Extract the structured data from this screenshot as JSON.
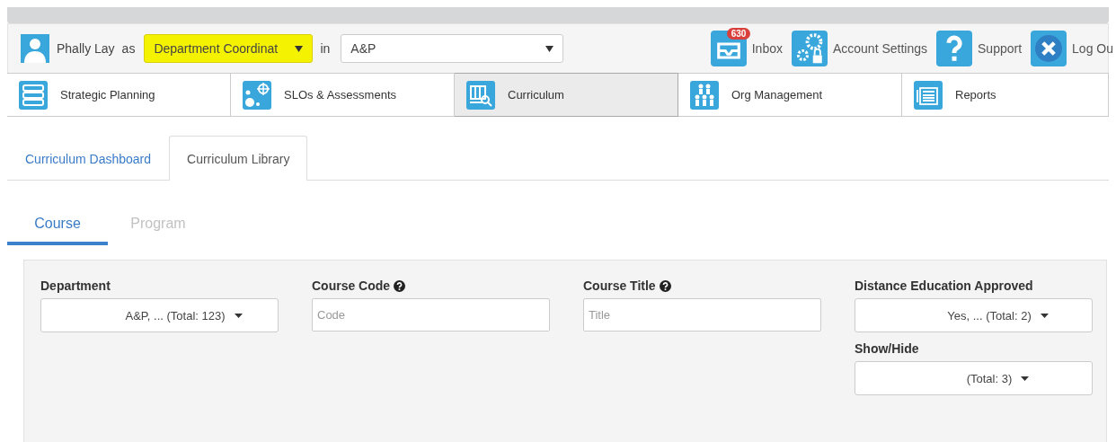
{
  "user_bar": {
    "user_name": "Phally Lay",
    "as_label": "as",
    "role_select": {
      "value": "Department Coordinat",
      "highlighted": true
    },
    "in_label": "in",
    "unit_select": {
      "value": "A&P"
    },
    "links": [
      {
        "kind": "inbox",
        "label": "Inbox",
        "badge": "630"
      },
      {
        "kind": "settings",
        "label": "Account Settings"
      },
      {
        "kind": "support",
        "label": "Support"
      },
      {
        "kind": "logout",
        "label": "Log Ou"
      }
    ]
  },
  "modules": [
    {
      "kind": "planning",
      "label": "Strategic Planning",
      "selected": false
    },
    {
      "kind": "slos",
      "label": "SLOs & Assessments",
      "selected": false
    },
    {
      "kind": "curriculum",
      "label": "Curriculum",
      "selected": true
    },
    {
      "kind": "org",
      "label": "Org Management",
      "selected": false
    },
    {
      "kind": "reports",
      "label": "Reports",
      "selected": false
    }
  ],
  "sub_tabs": [
    {
      "label": "Curriculum Dashboard",
      "selected": false
    },
    {
      "label": "Curriculum Library",
      "selected": true
    }
  ],
  "type_tabs": [
    {
      "label": "Course",
      "selected": true
    },
    {
      "label": "Program",
      "selected": false
    }
  ],
  "filters": [
    {
      "kind": "dropdown",
      "label": "Department",
      "value": "A&P, ... (Total: 123)"
    },
    {
      "kind": "text",
      "label": "Course Code",
      "help": true,
      "placeholder": "Code"
    },
    {
      "kind": "text",
      "label": "Course Title",
      "help": true,
      "placeholder": "Title"
    },
    {
      "kind": "dropdown",
      "label": "Distance Education Approved",
      "value": "Yes, ... (Total: 2)"
    },
    {
      "kind": "dropdown",
      "label": "Show/Hide",
      "value": "(Total: 3)"
    }
  ]
}
